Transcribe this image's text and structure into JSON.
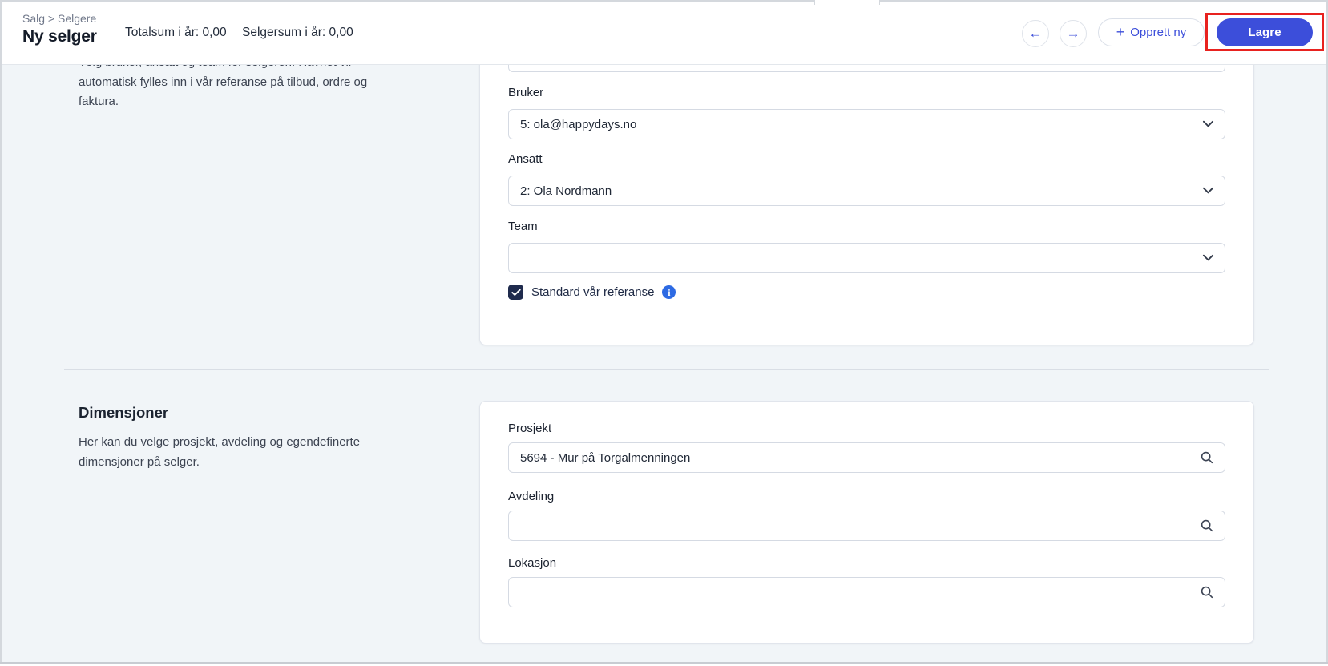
{
  "colors": {
    "accent_blue": "#3C4EDA",
    "annotation_red": "#E8221F",
    "checkbox_navy": "#1F2B4D",
    "info_blue": "#2D6AE3",
    "page_bg": "#F1F5F8"
  },
  "icons": {
    "back": "←",
    "forward": "→",
    "plus": "+",
    "info": "i"
  },
  "header": {
    "breadcrumb": "Salg > Selgere",
    "title": "Ny selger",
    "stat_total": "Totalsum i år: 0,00",
    "stat_seller": "Selgersum i år: 0,00",
    "create_new_label": "Opprett ny",
    "save_label": "Lagre"
  },
  "reference_section": {
    "description_clipped": "Velg bruker, ansatt og team for selgeren. Navnet vil",
    "description_line1": "automatisk fylles inn i vår referanse på tilbud, ordre og",
    "description_line2": "faktura.",
    "fields": {
      "bruker": {
        "label": "Bruker",
        "value": "5: ola@happydays.no"
      },
      "ansatt": {
        "label": "Ansatt",
        "value": "2: Ola Nordmann"
      },
      "team": {
        "label": "Team",
        "value": ""
      }
    },
    "checkbox": {
      "label": "Standard vår referanse",
      "checked": true
    }
  },
  "dimensions_section": {
    "heading": "Dimensjoner",
    "description_line1": "Her kan du velge prosjekt, avdeling og egendefinerte",
    "description_line2": "dimensjoner på selger.",
    "fields": {
      "prosjekt": {
        "label": "Prosjekt",
        "value": "5694 - Mur på Torgalmenningen"
      },
      "avdeling": {
        "label": "Avdeling",
        "value": ""
      },
      "lokasjon": {
        "label": "Lokasjon",
        "value": ""
      }
    }
  }
}
